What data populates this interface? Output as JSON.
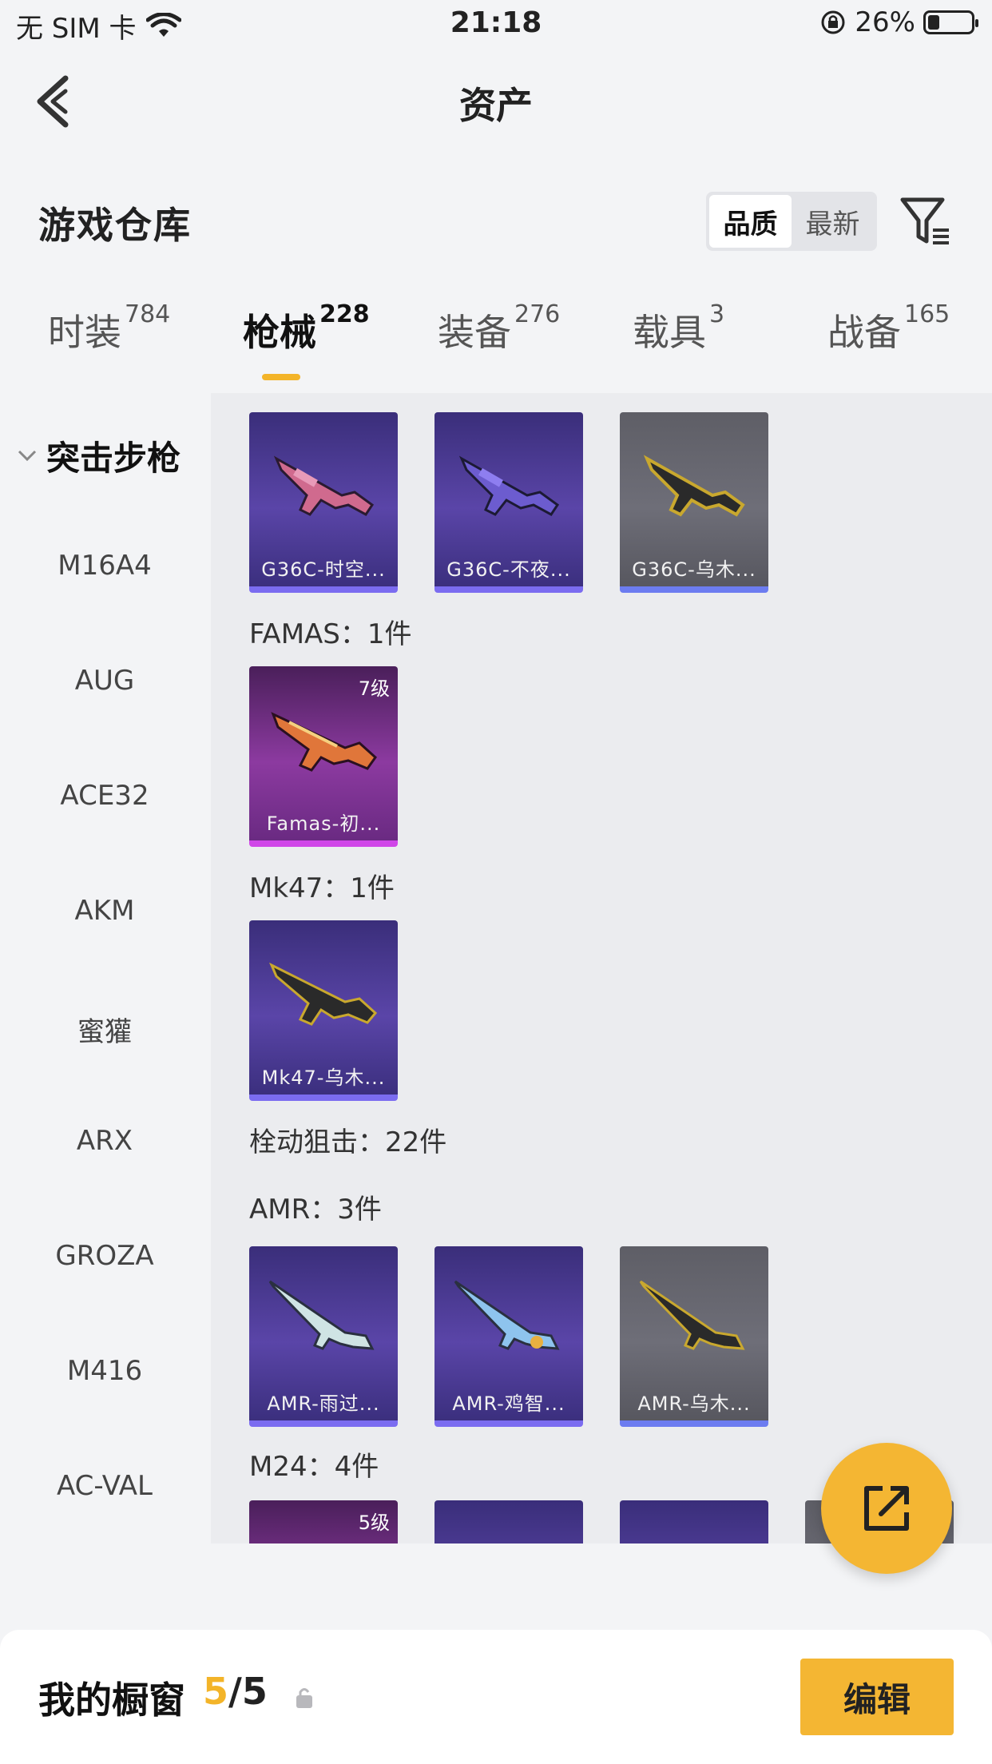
{
  "status_bar": {
    "carrier": "无 SIM 卡",
    "time": "21:18",
    "battery_text": "26%",
    "battery_level": 0.26
  },
  "nav": {
    "title": "资产"
  },
  "header": {
    "section_title": "游戏仓库",
    "sort_options": [
      "品质",
      "最新"
    ],
    "sort_active": "品质"
  },
  "tabs": [
    {
      "label": "时装",
      "count": "784"
    },
    {
      "label": "枪械",
      "count": "228"
    },
    {
      "label": "装备",
      "count": "276"
    },
    {
      "label": "载具",
      "count": "3"
    },
    {
      "label": "战备",
      "count": "165"
    }
  ],
  "active_tab": "枪械",
  "sidebar": {
    "group_label": "突击步枪",
    "items": [
      "M16A4",
      "AUG",
      "ACE32",
      "AKM",
      "蜜獾",
      "ARX",
      "GROZA",
      "M416",
      "AC-VAL"
    ]
  },
  "content": {
    "cards_row1": [
      {
        "name": "G36C-时空...",
        "rarity": "purple"
      },
      {
        "name": "G36C-不夜...",
        "rarity": "purple"
      },
      {
        "name": "G36C-乌木...",
        "rarity": "gray"
      }
    ],
    "famas_label": "FAMAS：1件",
    "famas_card": {
      "name": "Famas-初...",
      "level": "7级",
      "rarity": "magenta"
    },
    "mk47_label": "Mk47：1件",
    "mk47_card": {
      "name": "Mk47-乌木...",
      "rarity": "purple"
    },
    "bolt_label": "栓动狙击：22件",
    "amr_label": "AMR：3件",
    "amr_cards": [
      {
        "name": "AMR-雨过...",
        "rarity": "purple"
      },
      {
        "name": "AMR-鸡智...",
        "rarity": "purple"
      },
      {
        "name": "AMR-乌木...",
        "rarity": "gray"
      }
    ],
    "m24_label": "M24：4件",
    "m24_first_level": "5级"
  },
  "bottom_bar": {
    "window_label": "我的橱窗",
    "window_current": "5",
    "window_total": "/5",
    "edit_label": "编辑"
  },
  "colors": {
    "accent": "#f3b429",
    "purple_card": "#5a45a8",
    "gray_card": "#6e6e78",
    "magenta_card": "#8c3aa0"
  }
}
